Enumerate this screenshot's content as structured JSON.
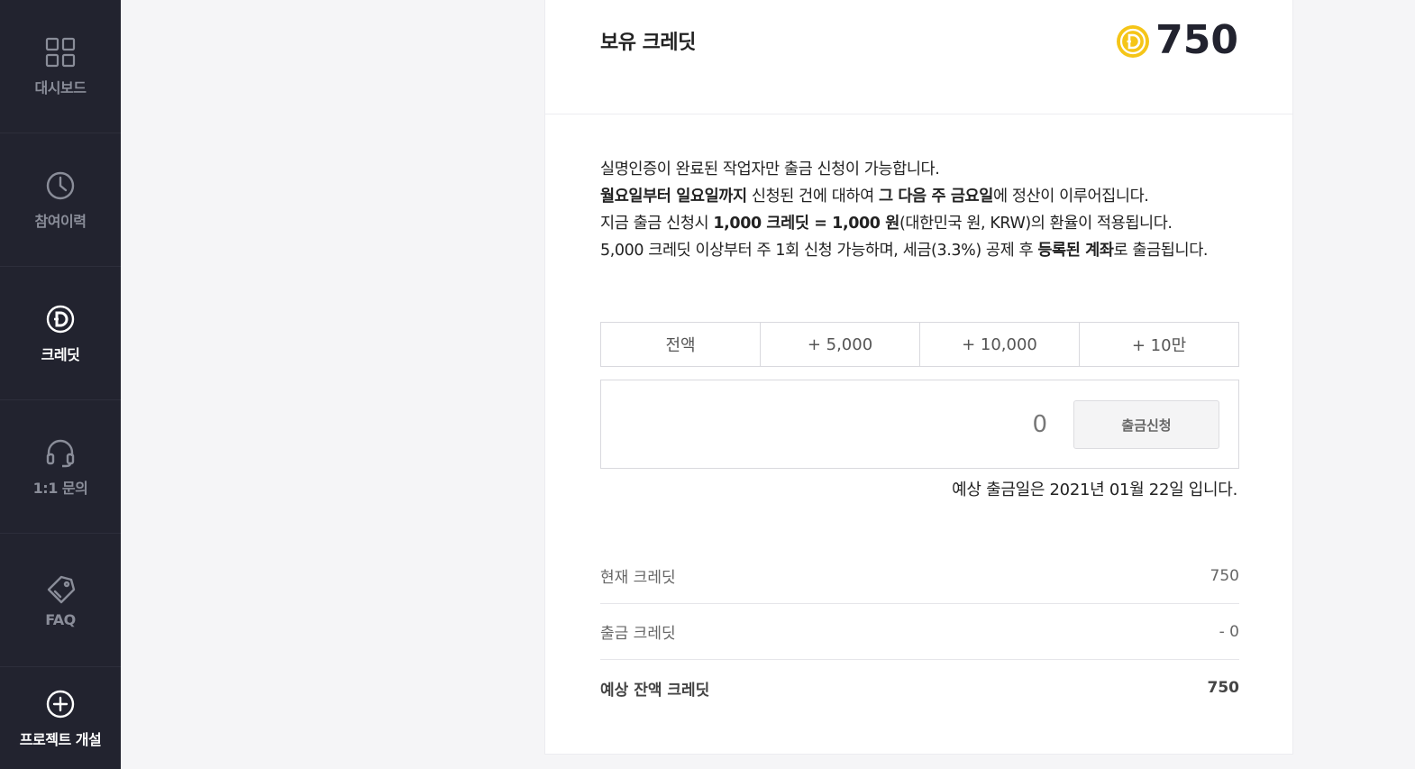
{
  "sidebar": {
    "items": [
      {
        "label": "대시보드",
        "icon": "grid-icon",
        "active": false
      },
      {
        "label": "참여이력",
        "icon": "clock-icon",
        "active": false
      },
      {
        "label": "크레딧",
        "icon": "credit-coin-icon",
        "active": true
      },
      {
        "label": "1:1 문의",
        "icon": "headset-icon",
        "active": false
      },
      {
        "label": "FAQ",
        "icon": "faq-tag-icon",
        "active": false
      },
      {
        "label": "프로젝트 개설",
        "icon": "plus-circle-icon",
        "active": false
      }
    ]
  },
  "header": {
    "title": "보유 크레딧",
    "amount": "750",
    "coin_color": "#f5c518"
  },
  "notice": {
    "line1": "실명인증이 완료된 작업자만 출금 신청이 가능합니다.",
    "line2_bold1": "월요일부터 일요일까지",
    "line2_text1": " 신청된 건에 대하여 ",
    "line2_bold2": "그 다음 주 금요일",
    "line2_text2": "에 정산이 이루어집니다.",
    "line3_text1": "지금 출금 신청시 ",
    "line3_bold": "1,000 크레딧 = 1,000 원",
    "line3_text2": "(대한민국 원, KRW)의 환율이 적용됩니다.",
    "line4_text1": "5,000 크레딧 이상부터 주 1회 신청 가능하며, 세금(3.3%) 공제 후 ",
    "line4_bold": "등록된 계좌",
    "line4_text2": "로 출금됩니다."
  },
  "quick_amounts": [
    "전액",
    "+ 5,000",
    "+ 10,000",
    "+ 10만"
  ],
  "withdraw": {
    "amount": "0",
    "button_label": "출금신청",
    "expected_date_text": "예상 출금일은 2021년 01월 22일 입니다."
  },
  "summary": [
    {
      "label": "현재 크레딧",
      "value": "750"
    },
    {
      "label": "출금 크레딧",
      "value": "- 0"
    },
    {
      "label": "예상 잔액 크레딧",
      "value": "750"
    }
  ],
  "colors": {
    "sidebar_bg": "#22232f",
    "accent_coin": "#f5c518"
  }
}
